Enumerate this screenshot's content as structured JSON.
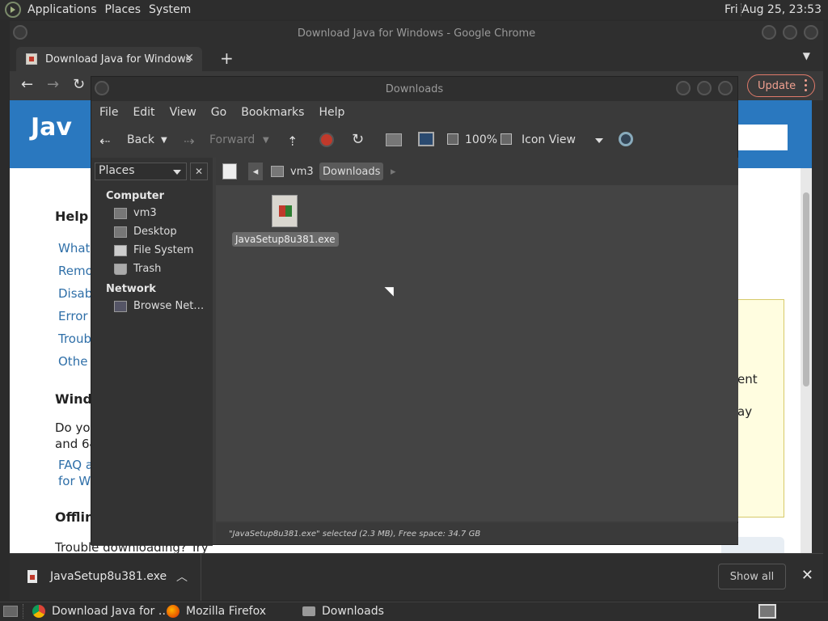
{
  "top_panel": {
    "menus": [
      "Applications",
      "Places",
      "System"
    ],
    "clock": "Fri Aug 25, 23:53"
  },
  "chrome": {
    "window_title": "Download Java for Windows - Google Chrome",
    "tab_title": "Download Java for Windows",
    "update_label": "Update",
    "page": {
      "banner_logo_text": "Jav",
      "heading_help": "Help R",
      "links": [
        "What",
        "Remo",
        "Disab",
        "Error",
        "Troub",
        "Othe"
      ],
      "heading_windows": "Windo",
      "body_text_1": "Do you",
      "body_text_2": "and 64",
      "faq_1": "FAQ a",
      "faq_2": "for Wi",
      "heading_offline": "Offlin",
      "trouble_text": "Trouble downloading? Try",
      "yellow_text_1": "ent",
      "yellow_text_2": "ay"
    },
    "download_bar": {
      "filename": "JavaSetup8u381.exe",
      "show_all": "Show all"
    }
  },
  "file_manager": {
    "window_title": "Downloads",
    "menu": [
      "File",
      "Edit",
      "View",
      "Go",
      "Bookmarks",
      "Help"
    ],
    "toolbar": {
      "back": "Back",
      "forward": "Forward",
      "zoom": "100%",
      "view_mode": "Icon View"
    },
    "side_panel": {
      "selector": "Places",
      "sections": [
        {
          "title": "Computer",
          "items": [
            "vm3",
            "Desktop",
            "File System",
            "Trash"
          ]
        },
        {
          "title": "Network",
          "items": [
            "Browse Net…"
          ]
        }
      ]
    },
    "pathbar": [
      "vm3",
      "Downloads"
    ],
    "files": [
      {
        "name": "JavaSetup8u381.exe"
      }
    ],
    "status": "\"JavaSetup8u381.exe\" selected (2.3 MB), Free space: 34.7 GB"
  },
  "taskbar": {
    "items": [
      "Download Java for …",
      "Mozilla Firefox",
      "Downloads"
    ]
  }
}
